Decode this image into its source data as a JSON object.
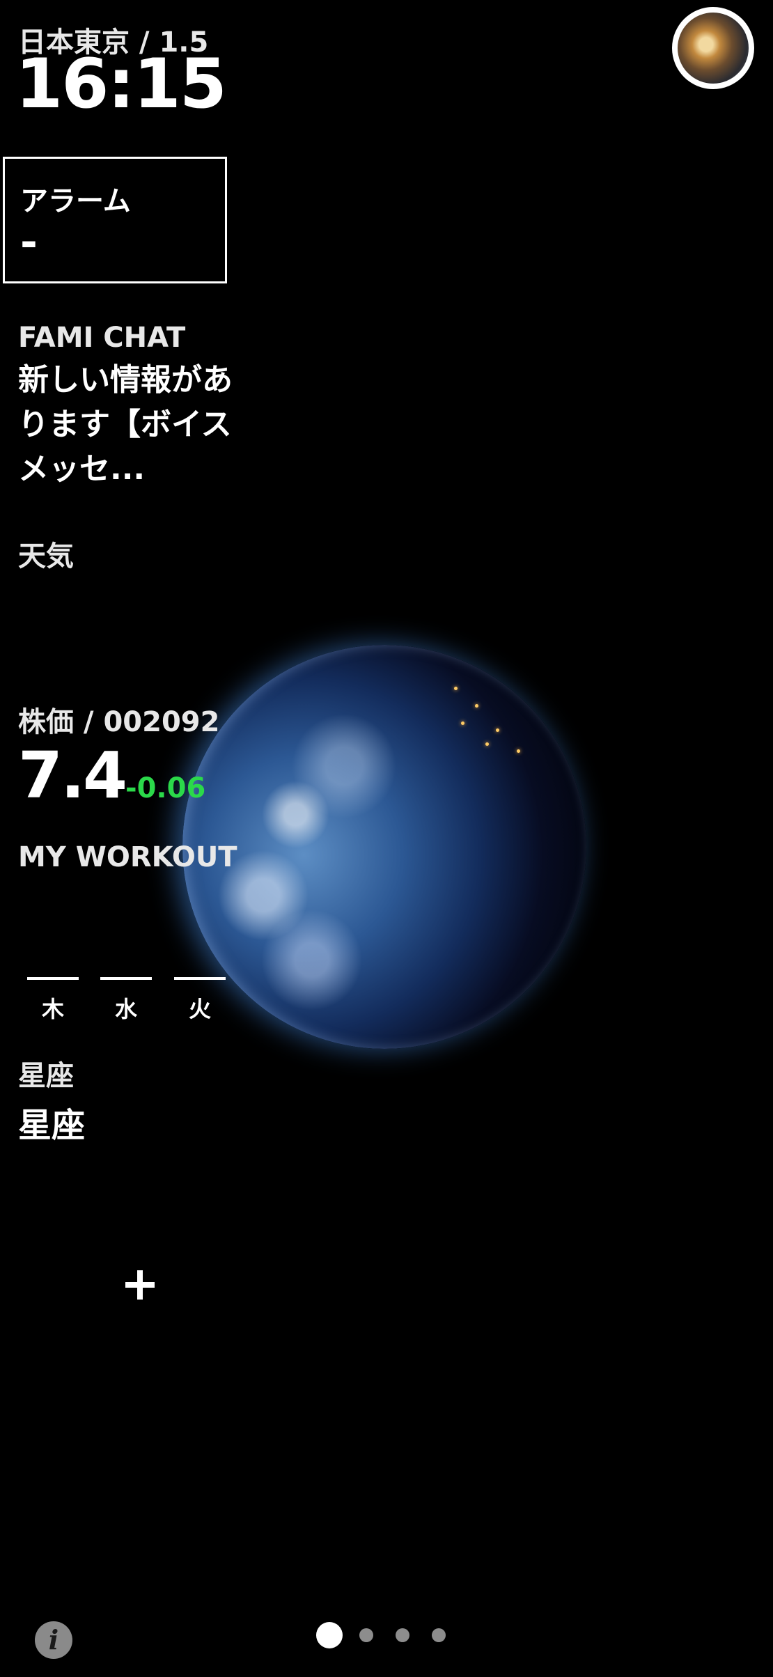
{
  "header": {
    "location_date": "日本東京 / 1.5",
    "time": "16:15"
  },
  "avatar": {
    "icon": "avatar-photo"
  },
  "alarm": {
    "title": "アラーム",
    "value": "-"
  },
  "chat": {
    "app_name": "FAMI CHAT",
    "message": "新しい情報があります【ボイスメッセ..."
  },
  "weather": {
    "title": "天気"
  },
  "stock": {
    "title": "株価 / 002092",
    "price": "7.4",
    "change": "-0.06",
    "change_color": "#2bd94a"
  },
  "workout": {
    "title": "MY WORKOUT",
    "days": [
      "木",
      "水",
      "火"
    ]
  },
  "horoscope": {
    "title": "星座",
    "value": "星座"
  },
  "add": {
    "icon": "plus-icon"
  },
  "footer": {
    "info_icon": "info-icon",
    "pages": 4,
    "active_page": 1
  }
}
